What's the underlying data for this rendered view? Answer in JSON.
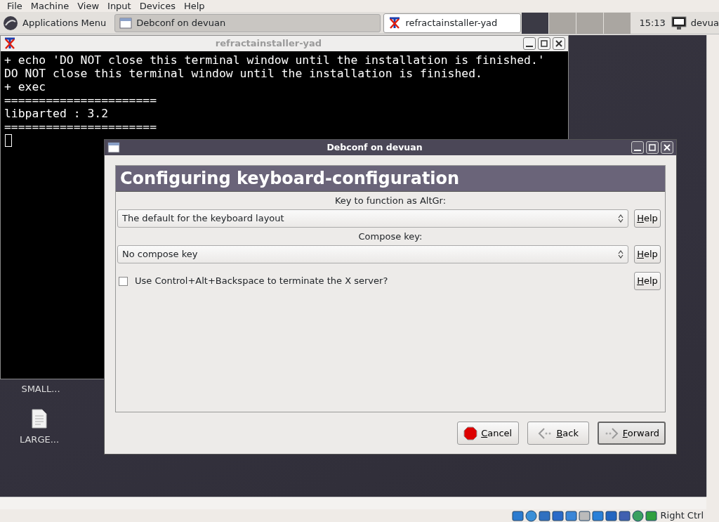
{
  "vm_menu": [
    "File",
    "Machine",
    "View",
    "Input",
    "Devices",
    "Help"
  ],
  "taskbar": {
    "apps_menu": "Applications Menu",
    "tasks": [
      {
        "label": "Debconf on devuan",
        "kind": "window",
        "selected": true
      },
      {
        "label": "refractainstaller-yad",
        "kind": "terminal",
        "selected": false
      }
    ],
    "clock": "15:13",
    "user": "devua"
  },
  "terminal": {
    "title": "refractainstaller-yad",
    "lines": [
      "+ echo 'DO NOT close this terminal window until the installation is finished.'",
      "DO NOT close this terminal window until the installation is finished.",
      "+ exec",
      "======================",
      "libparted : 3.2",
      "======================"
    ]
  },
  "desktop_icons": [
    {
      "label": "SMALL..."
    },
    {
      "label": "LARGE...",
      "kind": "document"
    }
  ],
  "dialog": {
    "title": "Debconf on devuan",
    "heading": "Configuring keyboard-configuration",
    "fields": [
      {
        "kind": "select",
        "label": "Key to function as AltGr:",
        "value": "The default for the keyboard layout",
        "help": "Help"
      },
      {
        "kind": "select",
        "label": "Compose key:",
        "value": "No compose key",
        "help": "Help"
      },
      {
        "kind": "checkbox",
        "text": "Use Control+Alt+Backspace to terminate the X server?",
        "checked": false,
        "help": "Help"
      }
    ],
    "buttons": [
      {
        "label": "Cancel",
        "kind": "cancel",
        "focused": false
      },
      {
        "label": "Back",
        "kind": "back",
        "focused": false
      },
      {
        "label": "Forward",
        "kind": "forward",
        "focused": true
      }
    ]
  },
  "status_bar": {
    "host_key": "Right Ctrl"
  }
}
